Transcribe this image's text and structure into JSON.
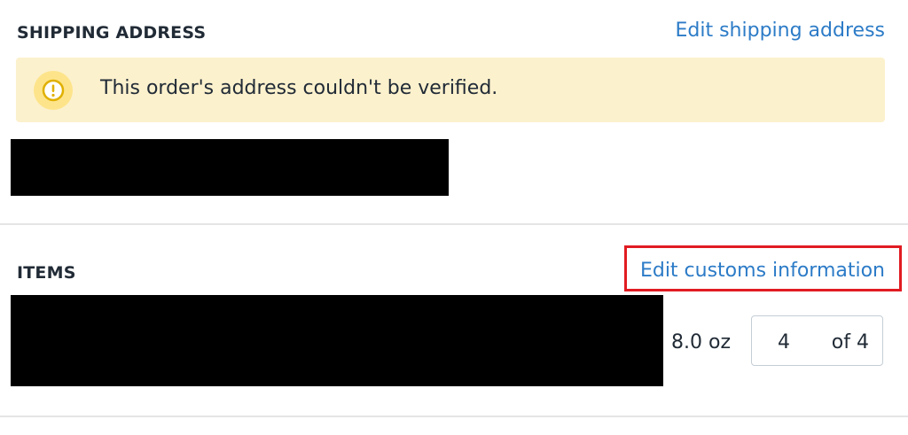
{
  "shipping": {
    "title": "SHIPPING ADDRESS",
    "edit_link": "Edit shipping address",
    "warning": {
      "icon": "exclamation-circle-icon",
      "text": "This order's address couldn't be verified."
    }
  },
  "items": {
    "title": "ITEMS",
    "edit_customs_link": "Edit customs information",
    "rows": [
      {
        "weight": "8.0 oz",
        "quantity": "4",
        "quantity_total": "of 4"
      }
    ]
  },
  "colors": {
    "link": "#2c7bc7",
    "warning_bg": "#fcf1cd",
    "warning_icon_bg": "#fde48b",
    "warning_icon": "#e0b000",
    "highlight": "#e11b22"
  }
}
